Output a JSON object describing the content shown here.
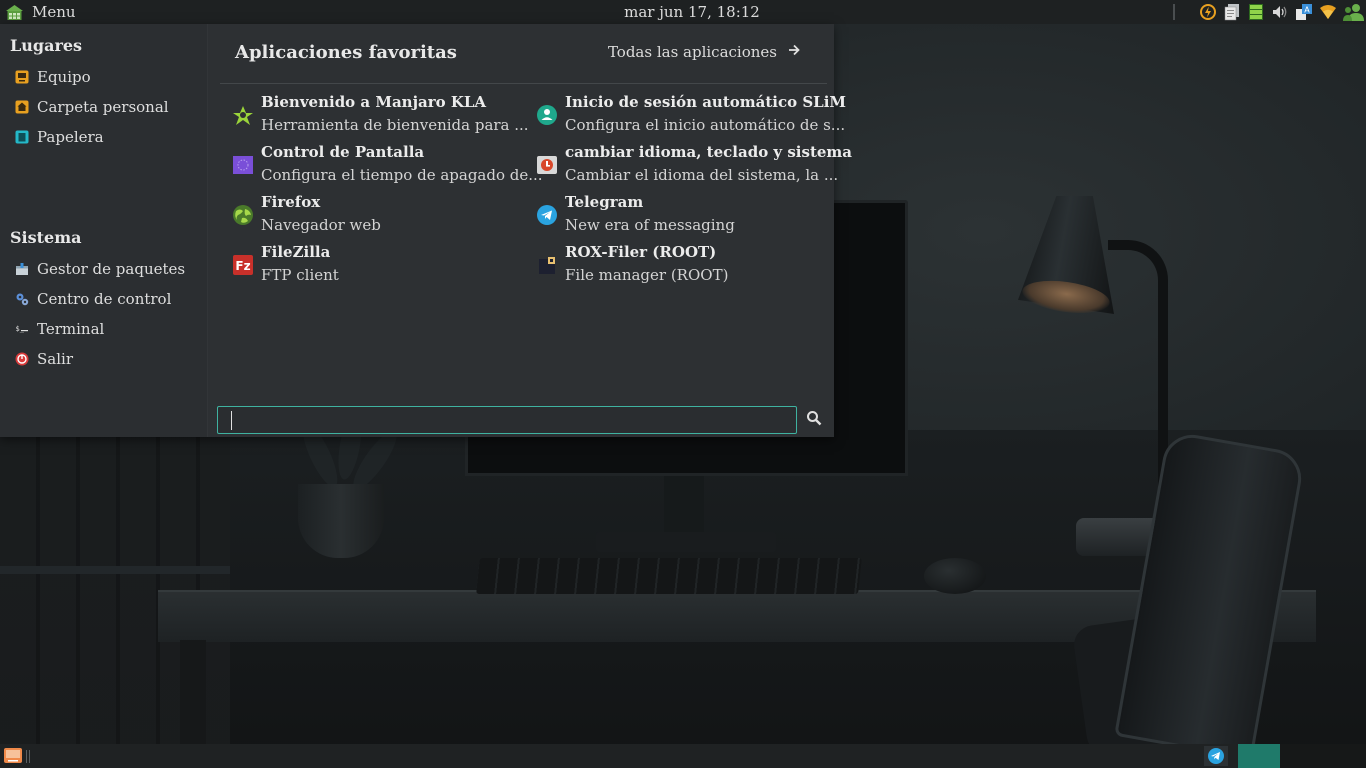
{
  "top_panel": {
    "menu_label": "Menu",
    "clock": "mar jun 17, 18:12",
    "tray_icons": [
      "power-manager-icon",
      "clipboard-icon",
      "battery-icon",
      "volume-icon",
      "keyboard-layout-icon",
      "wifi-icon",
      "user-icon"
    ]
  },
  "places": {
    "title": "Lugares",
    "items": [
      {
        "label": "Equipo",
        "icon": "computer-icon"
      },
      {
        "label": "Carpeta personal",
        "icon": "home-folder-icon"
      },
      {
        "label": "Papelera",
        "icon": "trash-icon"
      }
    ]
  },
  "system": {
    "title": "Sistema",
    "items": [
      {
        "label": "Gestor de paquetes",
        "icon": "package-manager-icon"
      },
      {
        "label": "Centro de control",
        "icon": "control-center-icon"
      },
      {
        "label": "Terminal",
        "icon": "terminal-icon"
      },
      {
        "label": "Salir",
        "icon": "power-icon"
      }
    ]
  },
  "favorites": {
    "title": "Aplicaciones favoritas",
    "all_apps_label": "Todas las aplicaciones",
    "apps": [
      {
        "name": "Bienvenido a Manjaro KLA",
        "desc": "Herramienta de bienvenida para ...",
        "icon": "manjaro-welcome-icon"
      },
      {
        "name": "Inicio de sesión automático SLiM",
        "desc": "Configura el inicio automático de s...",
        "icon": "autologin-user-icon"
      },
      {
        "name": "Control de Pantalla",
        "desc": "Configura el tiempo de apagado de...",
        "icon": "screen-control-icon"
      },
      {
        "name": "cambiar idioma, teclado y sistema",
        "desc": "Cambiar el idioma del sistema, la ...",
        "icon": "language-settings-icon"
      },
      {
        "name": "Firefox",
        "desc": "Navegador web",
        "icon": "firefox-globe-icon"
      },
      {
        "name": "Telegram",
        "desc": "New era of messaging",
        "icon": "telegram-icon"
      },
      {
        "name": "FileZilla",
        "desc": "FTP client",
        "icon": "filezilla-icon"
      },
      {
        "name": "ROX-Filer (ROOT)",
        "desc": "File manager (ROOT)",
        "icon": "rox-filer-icon"
      }
    ]
  },
  "search": {
    "value": "",
    "placeholder": ""
  },
  "colors": {
    "accent": "#3fb2a0",
    "workspace_active": "#1f7a6a",
    "panel_bg": "#1e2122",
    "menu_bg": "#2d3033"
  }
}
